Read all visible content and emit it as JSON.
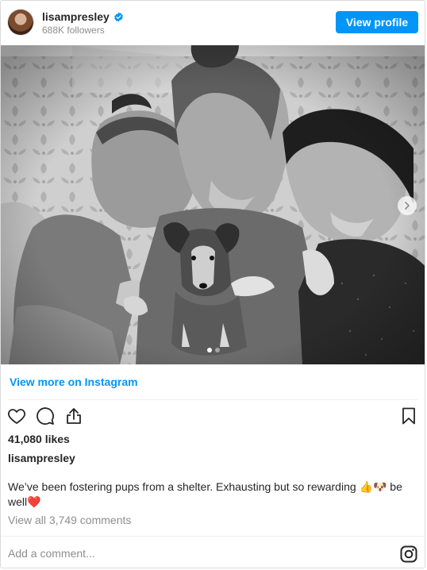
{
  "header": {
    "username": "lisampresley",
    "followers": "688K followers",
    "view_profile_label": "View profile"
  },
  "post": {
    "view_more_label": "View more on Instagram",
    "likes": "41,080 likes",
    "owner": "lisampresley",
    "caption_text": "We’ve been fostering pups from a shelter. Exhausting but so rewarding ",
    "caption_emoji_1": "👍🐶",
    "caption_text_2": " be well",
    "caption_emoji_2": "❤️",
    "view_comments_label": "View all 3,749 comments",
    "carousel_total": 2,
    "carousel_active": 1
  },
  "comment": {
    "placeholder": "Add a comment..."
  },
  "colors": {
    "accent": "#0095f6",
    "heart": "#ed1c24"
  },
  "icons": [
    "verified-badge-icon",
    "heart-icon",
    "comment-icon",
    "share-icon",
    "bookmark-icon",
    "chevron-right-icon",
    "instagram-icon"
  ]
}
